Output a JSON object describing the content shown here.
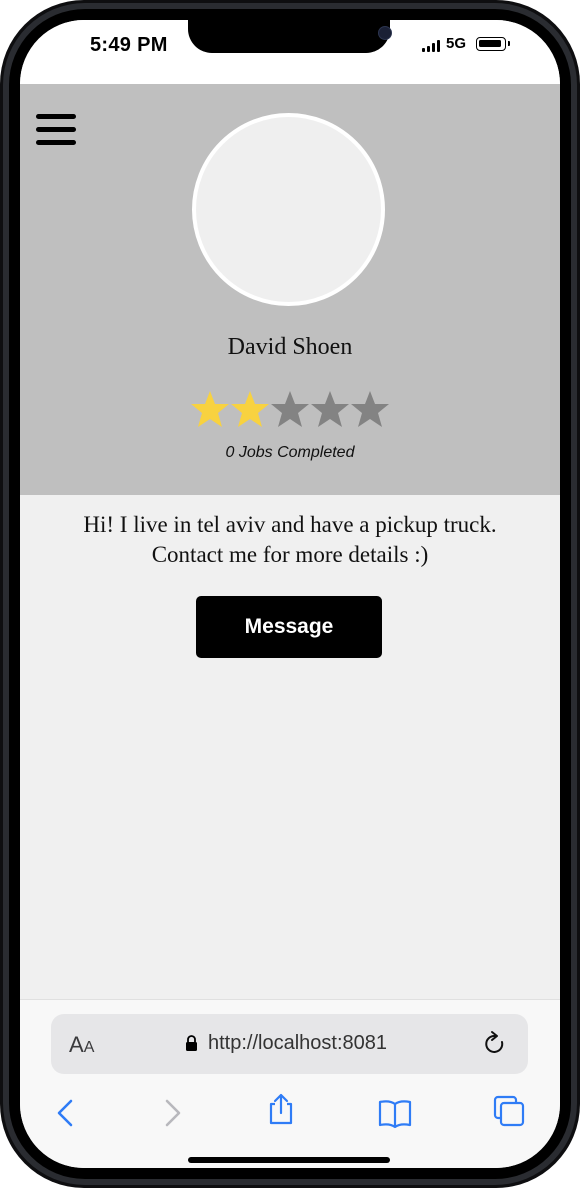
{
  "status_bar": {
    "time": "5:49 PM",
    "network": "5G"
  },
  "profile": {
    "name": "David Shoen",
    "rating": {
      "value": 2,
      "max": 5,
      "filled_color": "#f8d240",
      "empty_color": "#838383"
    },
    "jobs_completed": "0 Jobs Completed",
    "bio_lines": [
      "Hi! I live in tel aviv and have a pickup truck.",
      "Contact me for more details :)"
    ],
    "message_label": "Message"
  },
  "colors": {
    "header_bg": "#bfbfbf",
    "page_bg": "#f0f0f0",
    "button_bg": "#000000",
    "safari_blue": "#2f7cf6"
  },
  "browser": {
    "text_size_big": "A",
    "text_size_small": "A",
    "url": "http://localhost:8081",
    "icons": [
      "back-icon",
      "forward-icon",
      "share-icon",
      "bookmarks-icon",
      "tabs-icon"
    ]
  }
}
